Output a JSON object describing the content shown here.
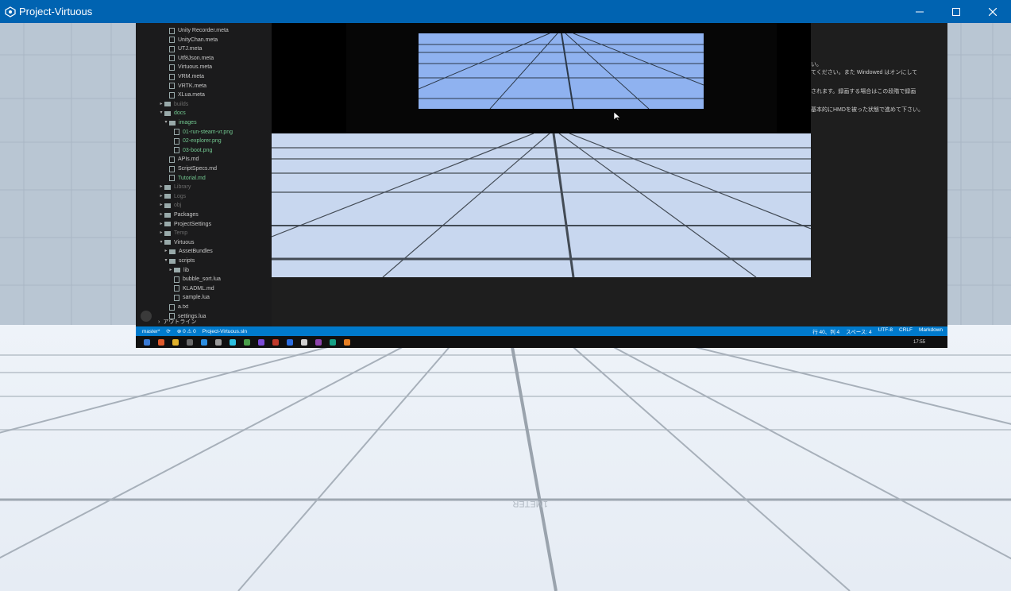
{
  "window": {
    "title": "Project-Virtuous",
    "controls": [
      "minimize",
      "maximize",
      "close"
    ]
  },
  "explorer": {
    "items": [
      {
        "label": "Unity Recorder.meta",
        "depth": 2,
        "kind": "file",
        "style": "normal"
      },
      {
        "label": "UnityChan.meta",
        "depth": 2,
        "kind": "file",
        "style": "normal"
      },
      {
        "label": "UTJ.meta",
        "depth": 2,
        "kind": "file",
        "style": "normal"
      },
      {
        "label": "Utf8Json.meta",
        "depth": 2,
        "kind": "file",
        "style": "normal"
      },
      {
        "label": "Virtuous.meta",
        "depth": 2,
        "kind": "file",
        "style": "normal"
      },
      {
        "label": "VRM.meta",
        "depth": 2,
        "kind": "file",
        "style": "normal"
      },
      {
        "label": "VRTK.meta",
        "depth": 2,
        "kind": "file",
        "style": "normal"
      },
      {
        "label": "XLua.meta",
        "depth": 2,
        "kind": "file",
        "style": "normal"
      },
      {
        "label": "builds",
        "depth": 1,
        "kind": "folder-closed",
        "style": "dim"
      },
      {
        "label": "docs",
        "depth": 1,
        "kind": "folder-open",
        "style": "green"
      },
      {
        "label": "images",
        "depth": 2,
        "kind": "folder-open",
        "style": "green"
      },
      {
        "label": "01-run-steam-vr.png",
        "depth": 3,
        "kind": "file",
        "style": "green"
      },
      {
        "label": "02-explorer.png",
        "depth": 3,
        "kind": "file",
        "style": "green"
      },
      {
        "label": "03-boot.png",
        "depth": 3,
        "kind": "file",
        "style": "green"
      },
      {
        "label": "APIs.md",
        "depth": 2,
        "kind": "file",
        "style": "normal"
      },
      {
        "label": "ScriptSpecs.md",
        "depth": 2,
        "kind": "file",
        "style": "normal"
      },
      {
        "label": "Tutorial.md",
        "depth": 2,
        "kind": "file",
        "style": "green"
      },
      {
        "label": "Library",
        "depth": 1,
        "kind": "folder-closed",
        "style": "dim"
      },
      {
        "label": "Logs",
        "depth": 1,
        "kind": "folder-closed",
        "style": "dim"
      },
      {
        "label": "obj",
        "depth": 1,
        "kind": "folder-closed",
        "style": "dim"
      },
      {
        "label": "Packages",
        "depth": 1,
        "kind": "folder-closed",
        "style": "normal"
      },
      {
        "label": "ProjectSettings",
        "depth": 1,
        "kind": "folder-closed",
        "style": "normal"
      },
      {
        "label": "Temp",
        "depth": 1,
        "kind": "folder-closed",
        "style": "dim"
      },
      {
        "label": "Virtuous",
        "depth": 1,
        "kind": "folder-open",
        "style": "normal"
      },
      {
        "label": "AssetBundles",
        "depth": 2,
        "kind": "folder-closed",
        "style": "normal"
      },
      {
        "label": "scripts",
        "depth": 2,
        "kind": "folder-open",
        "style": "normal"
      },
      {
        "label": "lib",
        "depth": 3,
        "kind": "folder-closed",
        "style": "normal"
      },
      {
        "label": "bubble_sort.lua",
        "depth": 3,
        "kind": "file",
        "style": "normal"
      },
      {
        "label": "KLADML.md",
        "depth": 3,
        "kind": "file",
        "style": "normal"
      },
      {
        "label": "sample.lua",
        "depth": 3,
        "kind": "file",
        "style": "normal"
      },
      {
        "label": "a.txt",
        "depth": 2,
        "kind": "file",
        "style": "normal"
      },
      {
        "label": "settings.lua",
        "depth": 2,
        "kind": "file",
        "style": "normal"
      }
    ],
    "outline_label": "アウトライン"
  },
  "editor_text": {
    "lines": [
      "い。",
      "てください。また Windowed はオンにして",
      "されます。録画する場合はこの段階で録画",
      "基本的にHMDを被った状態で進めて下さい。"
    ]
  },
  "statusbar": {
    "branch": "master*",
    "sync": "⟳",
    "problems": "⊗ 0 ⚠ 0",
    "solution": "Project-Virtuous.sln",
    "position": "行 40、列 4",
    "spaces": "スペース: 4",
    "encoding": "UTF-8",
    "eol": "CRLF",
    "language": "Markdown"
  },
  "taskbar": {
    "clock": "17:55"
  },
  "scene": {
    "floor_label": "1METER",
    "colors": {
      "sky": "#dfe6ee",
      "floor": "#e8eef6",
      "grid_line": "#9aa3ad",
      "window_accent": "#0063b1",
      "status_blue": "#007acc"
    }
  }
}
